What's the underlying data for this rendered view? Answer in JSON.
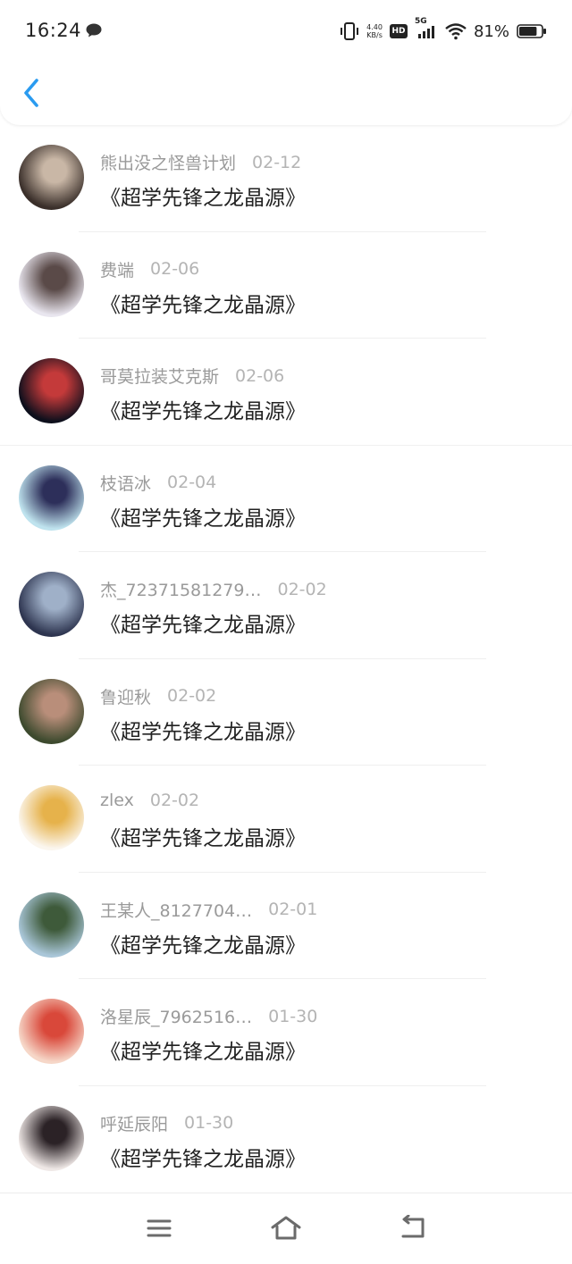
{
  "status_bar": {
    "time": "16:24",
    "net_speed_value": "4.40",
    "net_speed_unit": "KB/s",
    "hd_label": "HD",
    "network_label": "5G",
    "battery_text": "81%",
    "battery_level": 0.81
  },
  "header": {
    "back_icon": "chevron-left-icon"
  },
  "list": {
    "items": [
      {
        "name": "熊出没之怪兽计划",
        "date": "02-12",
        "title": "《超学先锋之龙晶源》",
        "avatar_colors": [
          "#3a2f2a",
          "#c9b7a6"
        ]
      },
      {
        "name": "费端",
        "date": "02-06",
        "title": "《超学先锋之龙晶源》",
        "avatar_colors": [
          "#e9e6ef",
          "#5a4a48"
        ]
      },
      {
        "name": "哥莫拉装艾克斯",
        "date": "02-06",
        "title": "《超学先锋之龙晶源》",
        "avatar_colors": [
          "#0d0f1c",
          "#c43a3a"
        ]
      },
      {
        "name": "枝语冰",
        "date": "02-04",
        "title": "《超学先锋之龙晶源》",
        "avatar_colors": [
          "#bfe3ee",
          "#2d2f5a"
        ]
      },
      {
        "name": "杰_72371581279…",
        "date": "02-02",
        "title": "《超学先锋之龙晶源》",
        "avatar_colors": [
          "#2e3550",
          "#9fb0c8"
        ]
      },
      {
        "name": "鲁迎秋",
        "date": "02-02",
        "title": "《超学先锋之龙晶源》",
        "avatar_colors": [
          "#3d4a2e",
          "#b98e7a"
        ]
      },
      {
        "name": "zlex",
        "date": "02-02",
        "title": "《超学先锋之龙晶源》",
        "avatar_colors": [
          "#fbf6ee",
          "#e6b24b"
        ]
      },
      {
        "name": "王某人_8127704…",
        "date": "02-01",
        "title": "《超学先锋之龙晶源》",
        "avatar_colors": [
          "#a9c6d8",
          "#3e5a3a"
        ]
      },
      {
        "name": "洛星辰_7962516…",
        "date": "01-30",
        "title": "《超学先锋之龙晶源》",
        "avatar_colors": [
          "#f6d7c8",
          "#d9483a"
        ]
      },
      {
        "name": "呼延辰阳",
        "date": "01-30",
        "title": "《超学先锋之龙晶源》",
        "avatar_colors": [
          "#efe8e6",
          "#2b2226"
        ]
      }
    ]
  },
  "navbar": {
    "menu_icon": "menu-icon",
    "home_icon": "home-icon",
    "back_icon": "back-arrow-icon"
  },
  "colors": {
    "accent": "#2a9bf0",
    "text_primary": "#222222",
    "text_secondary": "#9a9a9a",
    "icon_gray": "#6b6b6b"
  }
}
